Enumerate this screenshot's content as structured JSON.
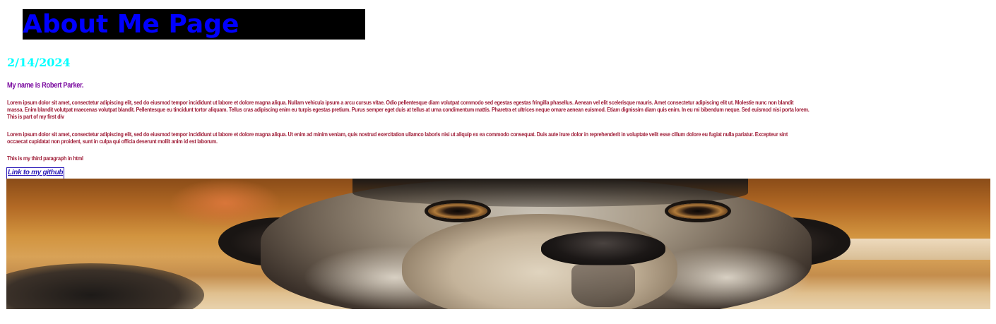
{
  "colors": {
    "title_text": "#0000ff",
    "title_background": "#000000",
    "date_text": "#00ffff",
    "intro_text": "#7b0ba0",
    "paragraph_text": "#a0203a",
    "link_text": "#2a1ab8"
  },
  "header": {
    "title": "About Me Page"
  },
  "date": "2/14/2024",
  "intro": "My name is Robert Parker.",
  "paragraphs": {
    "first_lines": [
      "Lorem ipsum dolor sit amet, consectetur adipiscing elit, sed do eiusmod tempor incididunt ut labore et dolore magna aliqua. Nullam vehicula ipsum a arcu cursus vitae. Odio pellentesque diam volutpat commodo sed egestas egestas fringilla phasellus. Aenean vel elit scelerisque mauris. Amet consectetur adipiscing elit ut. Molestie nunc non blandit",
      "massa. Enim blandit volutpat maecenas volutpat blandit. Pellentesque eu tincidunt tortor aliquam. Tellus cras adipiscing enim eu turpis egestas pretium. Purus semper eget duis at tellus at urna condimentum mattis. Pharetra et ultrices neque ornare aenean euismod. Etiam dignissim diam quis enim. In eu mi bibendum neque. Sed euismod nisi porta lorem.",
      "This is part of my first div"
    ],
    "second_lines": [
      "Lorem ipsum dolor sit amet, consectetur adipiscing elit, sed do eiusmod tempor incididunt ut labore et dolore magna aliqua. Ut enim ad minim veniam, quis nostrud exercitation ullamco laboris nisi ut aliquip ex ea commodo consequat. Duis aute irure dolor in reprehenderit in voluptate velit esse cillum dolore eu fugiat nulla pariatur. Excepteur sint",
      "occaecat cupidatat non proident, sunt in culpa qui officia deserunt mollit anim id est laborum."
    ],
    "third": "This is my third paragraph in html"
  },
  "link": {
    "label": "Link to my github"
  },
  "image": {
    "subject": "dog-photo"
  }
}
